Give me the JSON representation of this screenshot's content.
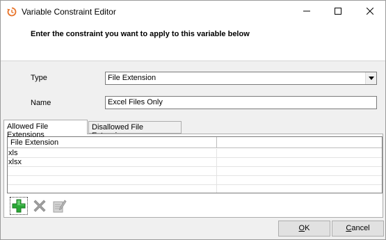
{
  "window": {
    "title": "Variable Constraint Editor"
  },
  "header": {
    "instruction": "Enter the constraint you want to apply to this variable below"
  },
  "form": {
    "type_label": "Type",
    "type_value": "File Extension",
    "name_label": "Name",
    "name_value": "Excel Files Only"
  },
  "tabs": [
    {
      "label": "Allowed File Extensions",
      "selected": true
    },
    {
      "label": "Disallowed File Extensions",
      "selected": false
    }
  ],
  "grid": {
    "column_header": "File Extension",
    "rows": [
      "xls",
      "xlsx",
      "",
      "",
      ""
    ]
  },
  "toolbar": {
    "add_icon": "add-icon",
    "remove_icon": "remove-icon",
    "edit_icon": "edit-icon"
  },
  "buttons": {
    "ok_first": "O",
    "ok_rest": "K",
    "cancel_first": "C",
    "cancel_rest": "ancel"
  },
  "colors": {
    "add_green": "#2aa836",
    "disabled_gray": "#a0a0a0",
    "app_icon_orange": "#e8742a"
  }
}
